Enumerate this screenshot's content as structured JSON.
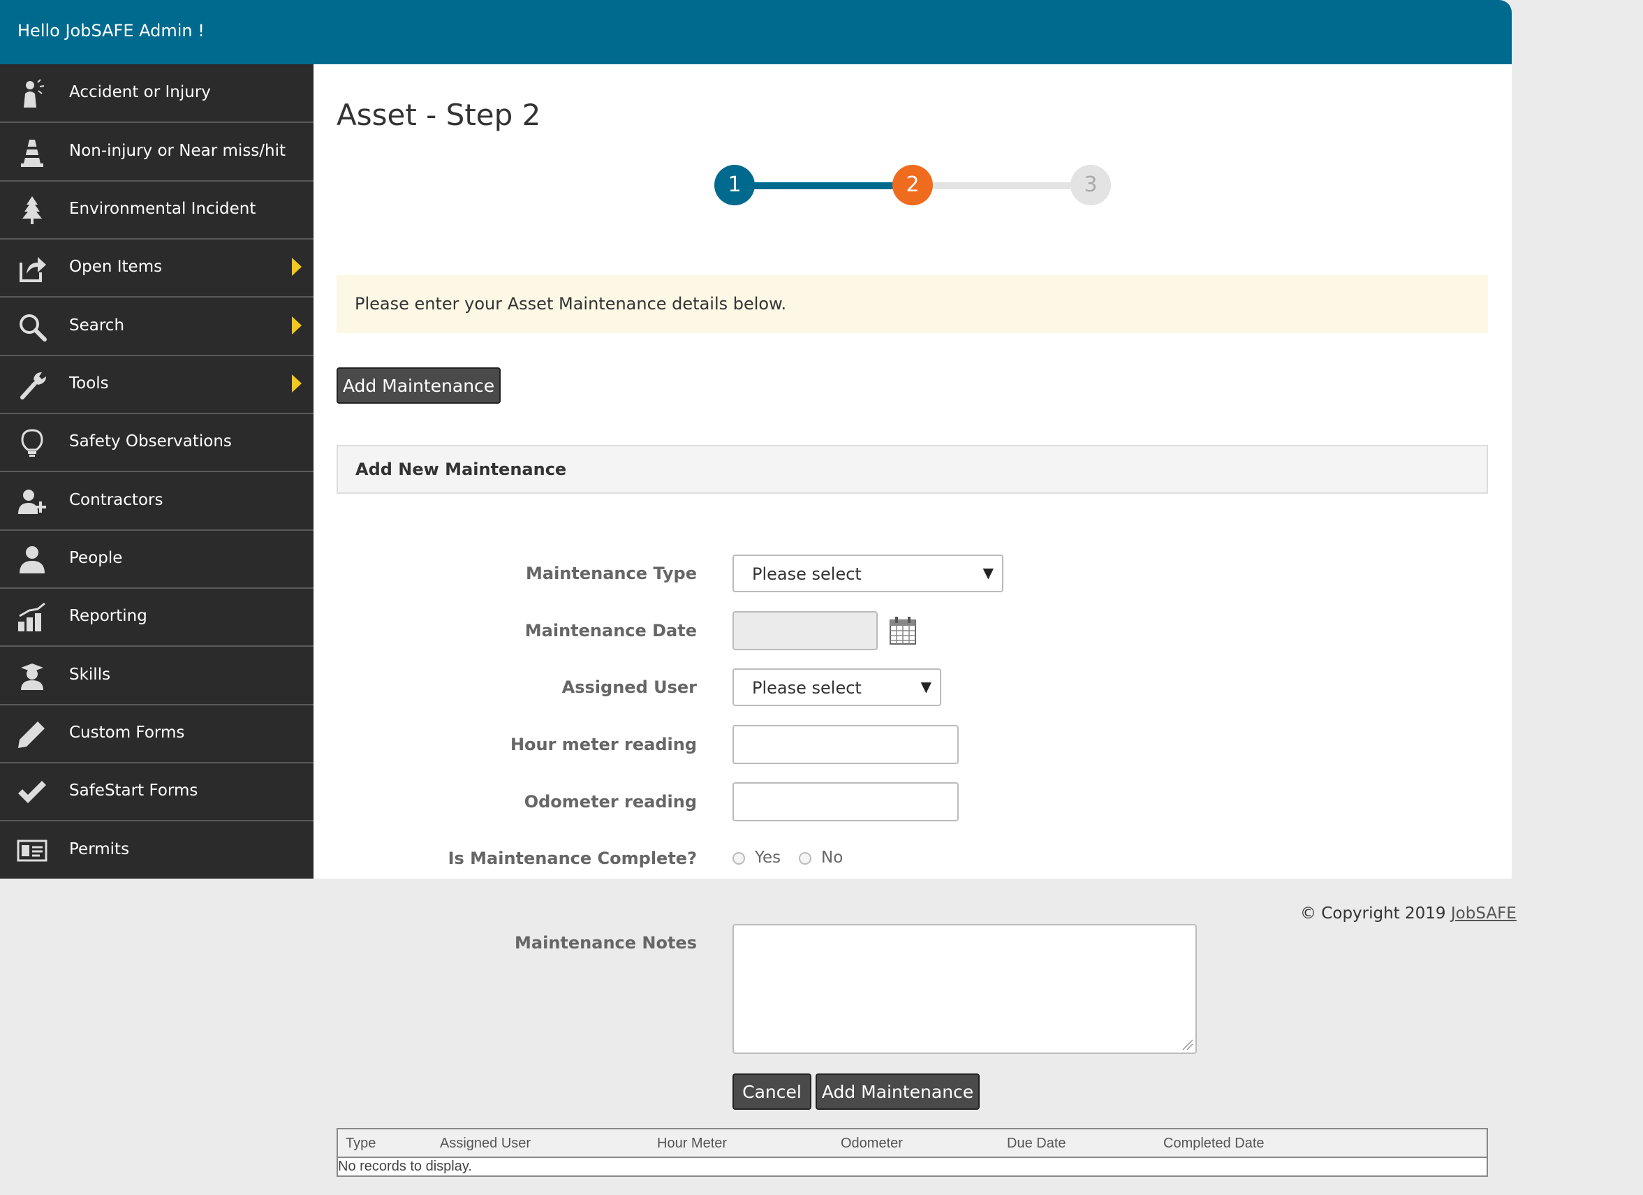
{
  "header": {
    "greeting": "Hello JobSAFE Admin !"
  },
  "sidebar": {
    "items": [
      {
        "label": "Accident or Injury",
        "icon": "injured-person-icon",
        "has_submenu": false
      },
      {
        "label": "Non-injury or Near miss/hit",
        "icon": "traffic-cone-icon",
        "has_submenu": false
      },
      {
        "label": "Environmental Incident",
        "icon": "tree-icon",
        "has_submenu": false
      },
      {
        "label": "Open Items",
        "icon": "share-icon",
        "has_submenu": true
      },
      {
        "label": "Search",
        "icon": "search-icon",
        "has_submenu": true
      },
      {
        "label": "Tools",
        "icon": "wrench-icon",
        "has_submenu": true
      },
      {
        "label": "Safety Observations",
        "icon": "lightbulb-icon",
        "has_submenu": false
      },
      {
        "label": "Contractors",
        "icon": "add-user-icon",
        "has_submenu": false
      },
      {
        "label": "People",
        "icon": "person-icon",
        "has_submenu": false
      },
      {
        "label": "Reporting",
        "icon": "bar-chart-icon",
        "has_submenu": false
      },
      {
        "label": "Skills",
        "icon": "graduate-icon",
        "has_submenu": false
      },
      {
        "label": "Custom Forms",
        "icon": "pencil-icon",
        "has_submenu": false
      },
      {
        "label": "SafeStart Forms",
        "icon": "checkmark-icon",
        "has_submenu": false
      },
      {
        "label": "Permits",
        "icon": "id-card-icon",
        "has_submenu": false
      }
    ]
  },
  "main": {
    "title": "Asset - Step 2",
    "stepper": {
      "steps": [
        "1",
        "2",
        "3"
      ],
      "current": 2
    },
    "info_message": "Please enter your Asset Maintenance details below.",
    "add_button_label": "Add Maintenance",
    "panel_title": "Add New Maintenance"
  },
  "form": {
    "maintenance_type": {
      "label": "Maintenance Type",
      "value": "Please select"
    },
    "maintenance_date": {
      "label": "Maintenance Date",
      "value": ""
    },
    "assigned_user": {
      "label": "Assigned User",
      "value": "Please select"
    },
    "hour_meter": {
      "label": "Hour meter reading",
      "value": ""
    },
    "odometer": {
      "label": "Odometer reading",
      "value": ""
    },
    "complete": {
      "label": "Is Maintenance Complete?",
      "options": [
        "Yes",
        "No"
      ],
      "selected": null
    },
    "notes": {
      "label": "Maintenance Notes",
      "value": ""
    },
    "cancel_label": "Cancel",
    "submit_label": "Add Maintenance"
  },
  "footer": {
    "copyright_prefix": "© Copyright 2019",
    "copyright_link": "JobSAFE"
  },
  "grid": {
    "columns": [
      "Type",
      "Assigned User",
      "Hour Meter",
      "Odometer",
      "Due Date",
      "Completed Date"
    ],
    "empty_message": "No records to display."
  },
  "colors": {
    "brand_blue": "#006a8e",
    "active_step": "#ef6c1e",
    "sidebar_bg": "#2b2b2b",
    "submenu_arrow": "#f3c81c",
    "info_bg": "#fcf8e5"
  }
}
